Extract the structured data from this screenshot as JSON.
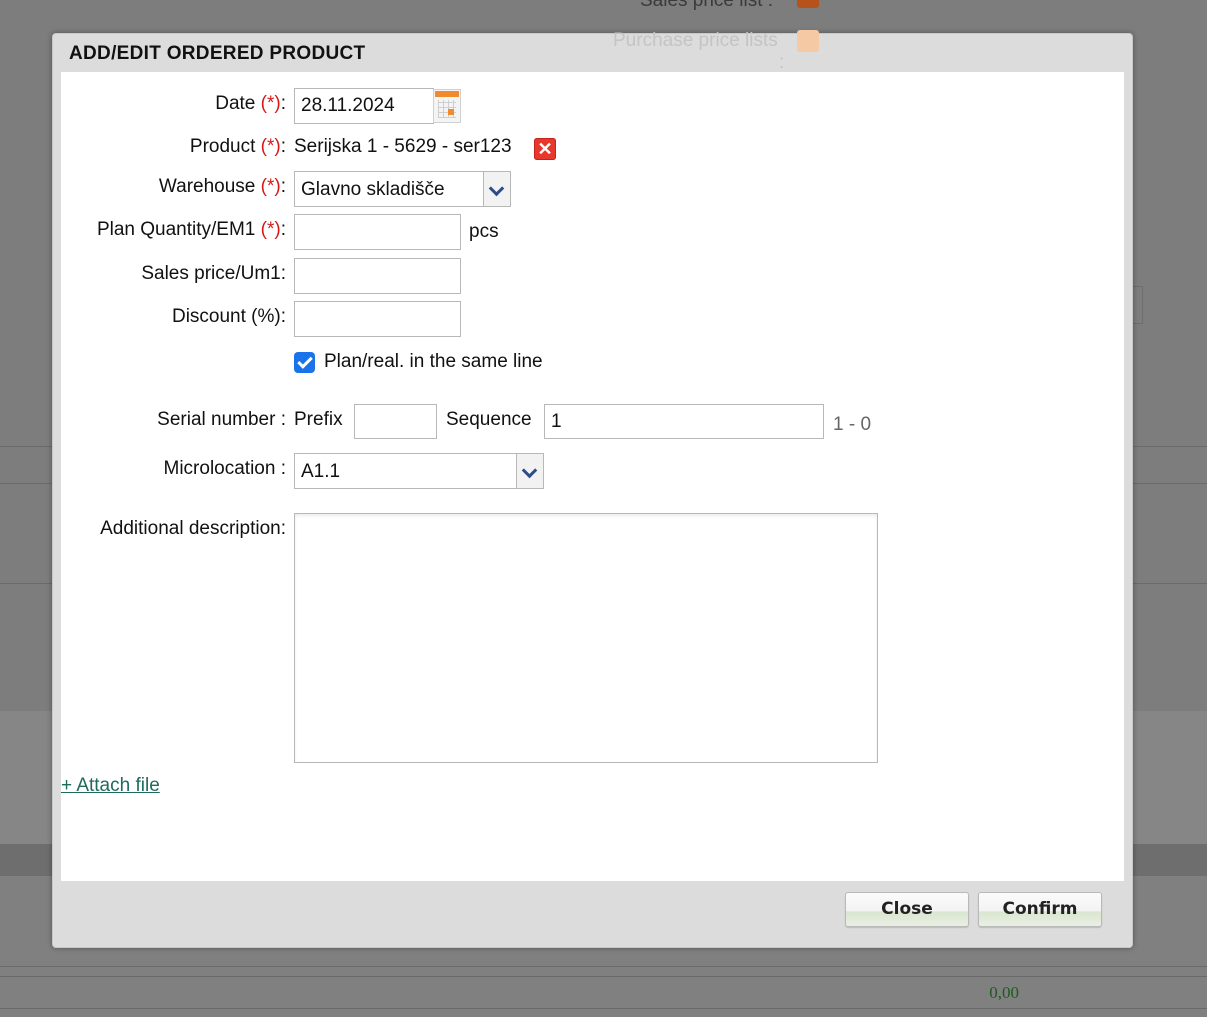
{
  "background": {
    "top_label_1": "Sales price list  :",
    "top_label_2": "Purchase price lists",
    "top_colon": ":",
    "amount": "0,00"
  },
  "modal": {
    "title": "ADD/EDIT ORDERED PRODUCT",
    "required_marker": "(*)",
    "fields": {
      "date": {
        "label": "Date",
        "value": "28.11.2024"
      },
      "product": {
        "label": "Product",
        "value": "Serijska 1 - 5629 - ser123"
      },
      "warehouse": {
        "label": "Warehouse",
        "value": "Glavno skladišče"
      },
      "plan_quantity": {
        "label": "Plan Quantity/EM1",
        "value": "",
        "unit": "pcs"
      },
      "sales_price": {
        "label": "Sales price/Um1:",
        "value": ""
      },
      "discount": {
        "label": "Discount (%):",
        "value": ""
      },
      "same_line": {
        "label": "Plan/real. in the same line",
        "checked": true
      },
      "serial_number": {
        "label": "Serial number :",
        "prefix_label": "Prefix",
        "prefix_value": "",
        "sequence_label": "Sequence",
        "sequence_value": "1",
        "range": "1 - 0"
      },
      "microlocation": {
        "label": "Microlocation :",
        "value": "A1.1"
      },
      "additional_description": {
        "label": "Additional description:",
        "value": ""
      }
    },
    "attach_file": "+ Attach file",
    "buttons": {
      "close": "Close",
      "confirm": "Confirm"
    }
  },
  "colors": {
    "required": "#d61a1a",
    "link": "#1e6b5b",
    "checkbox": "#1a73e8",
    "calendar_accent": "#f08a2a",
    "remove_icon": "#e8372c",
    "dropdown_arrow": "#2e4b8c"
  },
  "icons": {
    "calendar": "calendar-icon",
    "remove": "remove-x-icon",
    "dropdown": "chevron-down-icon",
    "check": "checkmark-icon"
  }
}
